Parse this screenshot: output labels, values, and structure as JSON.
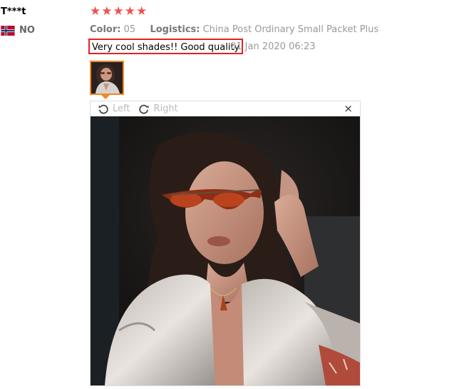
{
  "reviewer": {
    "name": "T***t",
    "country_code": "NO",
    "flag_icon": "norway-flag-icon"
  },
  "rating": {
    "stars": 5,
    "star_color": "#ef5350"
  },
  "meta": {
    "color_label": "Color:",
    "color_value": "05",
    "logistics_label": "Logistics:",
    "logistics_value": "China Post Ordinary Small Packet Plus"
  },
  "review": {
    "text": "Very cool shades!! Good quality",
    "date": "01 Jan 2020 06:23",
    "highlight_color": "#e02424"
  },
  "viewer": {
    "rotate_left_label": "Left",
    "rotate_right_label": "Right",
    "close_label": "×",
    "thumb_border_color": "#f08a24"
  }
}
